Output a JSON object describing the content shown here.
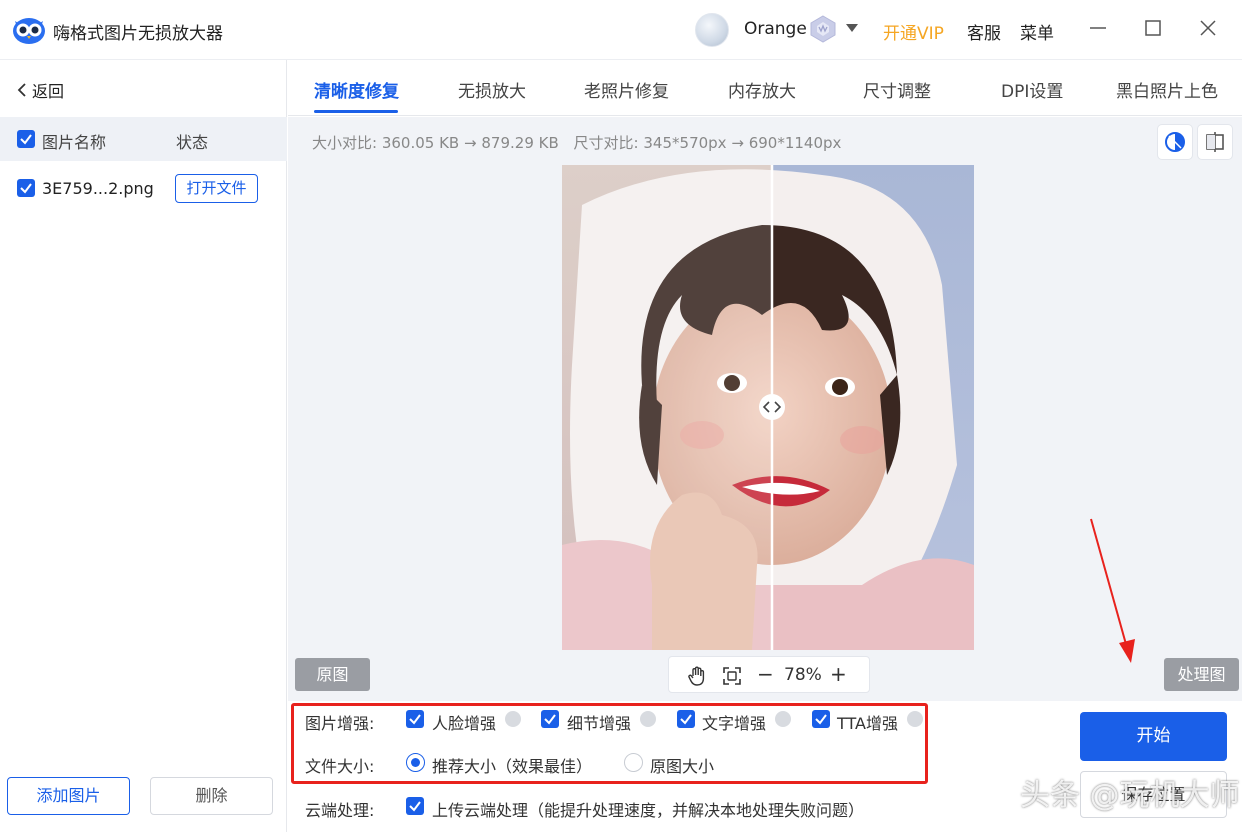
{
  "app": {
    "title": "嗨格式图片无损放大器",
    "username": "Orange",
    "vip_link": "开通VIP",
    "service_link": "客服",
    "menu_link": "菜单"
  },
  "sidebar": {
    "back_label": "返回",
    "header_name": "图片名称",
    "header_status": "状态",
    "files": [
      {
        "name": "3E759...2.png",
        "action": "打开文件",
        "checked": true
      }
    ],
    "add_button": "添加图片",
    "delete_button": "删除"
  },
  "tabs": [
    {
      "label": "清晰度修复",
      "active": true
    },
    {
      "label": "无损放大",
      "active": false
    },
    {
      "label": "老照片修复",
      "active": false
    },
    {
      "label": "内存放大",
      "active": false
    },
    {
      "label": "尺寸调整",
      "active": false
    },
    {
      "label": "DPI设置",
      "active": false
    },
    {
      "label": "黑白照片上色",
      "active": false
    }
  ],
  "preview": {
    "size_compare_label": "大小对比:",
    "size_before": "360.05 KB",
    "size_after": "879.29 KB",
    "dim_compare_label": "尺寸对比:",
    "dim_before": "345*570px",
    "dim_after": "690*1140px",
    "arrow": "→",
    "original_button": "原图",
    "processed_button": "处理图",
    "zoom_minus": "−",
    "zoom_value": "78%",
    "zoom_plus": "+"
  },
  "options": {
    "enhance_label": "图片增强:",
    "enhance_items": [
      {
        "label": "人脸增强",
        "checked": true
      },
      {
        "label": "细节增强",
        "checked": true
      },
      {
        "label": "文字增强",
        "checked": true
      },
      {
        "label": "TTA增强",
        "checked": true
      }
    ],
    "filesize_label": "文件大小:",
    "filesize_options": [
      {
        "label": "推荐大小（效果最佳）",
        "selected": true
      },
      {
        "label": "原图大小",
        "selected": false
      }
    ],
    "cloud_label": "云端处理:",
    "cloud_option": "上传云端处理（能提升处理速度，并解决本地处理失败问题）",
    "cloud_checked": true
  },
  "actions": {
    "start_button": "开始",
    "save_button": "保存位置"
  },
  "watermark": "头条 @玩机大师",
  "colors": {
    "accent": "#1a5fe8",
    "vip": "#f5a623",
    "highlight_box": "#e8221d",
    "annotation_arrow": "#e8221d"
  }
}
